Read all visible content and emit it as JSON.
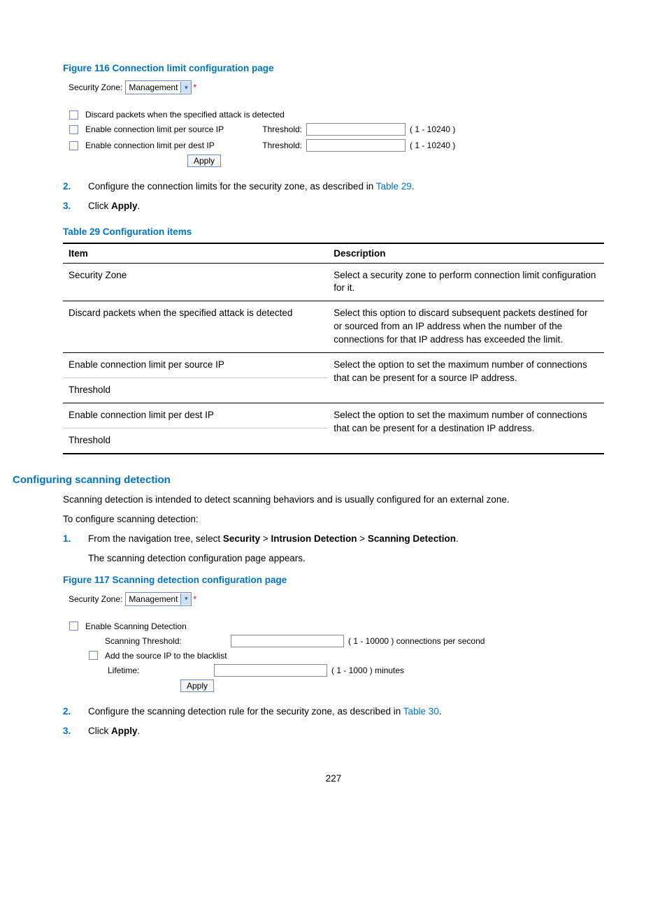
{
  "fig116_caption": "Figure 116 Connection limit configuration page",
  "sz_label": "Security Zone:",
  "sz_value": "Management",
  "asterisk": "*",
  "f116": {
    "opt1": "Discard packets when the specified attack is detected",
    "opt2": "Enable connection limit per source IP",
    "opt3": "Enable connection limit per dest IP",
    "threshold": "Threshold:",
    "range": "( 1 - 10240 )",
    "apply": "Apply"
  },
  "step2_num": "2.",
  "step2_a": "Configure the connection limits for the security zone, as described in ",
  "step2_link": "Table 29",
  "step2_b": ".",
  "step3_num": "3.",
  "step3_a": "Click ",
  "step3_bold": "Apply",
  "step3_b": ".",
  "table29_caption": "Table 29 Configuration items",
  "t29": {
    "h1": "Item",
    "h2": "Description",
    "r1c1": "Security Zone",
    "r1c2": "Select a security zone to perform connection limit configuration for it.",
    "r2c1": "Discard packets when the specified attack is detected",
    "r2c2": "Select this option to discard subsequent packets destined for or sourced from an IP address when the number of the connections for that IP address has exceeded the limit.",
    "r3c1": "Enable connection limit per source IP",
    "r4c1": "Threshold",
    "r34c2": "Select the option to set the maximum number of connections that can be present for a source IP address.",
    "r5c1": "Enable connection limit per dest IP",
    "r6c1": "Threshold",
    "r56c2": "Select the option to set the maximum number of connections that can be present for a destination IP address."
  },
  "sec_h": "Configuring scanning detection",
  "para1": "Scanning detection is intended to detect scanning behaviors and is usually configured for an external zone.",
  "para2": "To configure scanning detection:",
  "s1_num": "1.",
  "s1_a": "From the navigation tree, select ",
  "s1_b1": "Security",
  "s1_gt1": " > ",
  "s1_b2": "Intrusion Detection",
  "s1_gt2": " > ",
  "s1_b3": "Scanning Detection",
  "s1_c": ".",
  "s1_sub": "The scanning detection configuration page appears.",
  "fig117_caption": "Figure 117 Scanning detection configuration page",
  "f117": {
    "enable": "Enable Scanning Detection",
    "scanth": "Scanning Threshold:",
    "range1": "( 1 - 10000 ) connections per second",
    "addbl": "Add the source IP to the blacklist",
    "lifetime": "Lifetime:",
    "range2": "( 1 - 1000 ) minutes",
    "apply": "Apply"
  },
  "sd2_num": "2.",
  "sd2_a": "Configure the scanning detection rule for the security zone, as described in ",
  "sd2_link": "Table 30",
  "sd2_b": ".",
  "sd3_num": "3.",
  "sd3_a": "Click ",
  "sd3_bold": "Apply",
  "sd3_b": ".",
  "pageno": "227"
}
